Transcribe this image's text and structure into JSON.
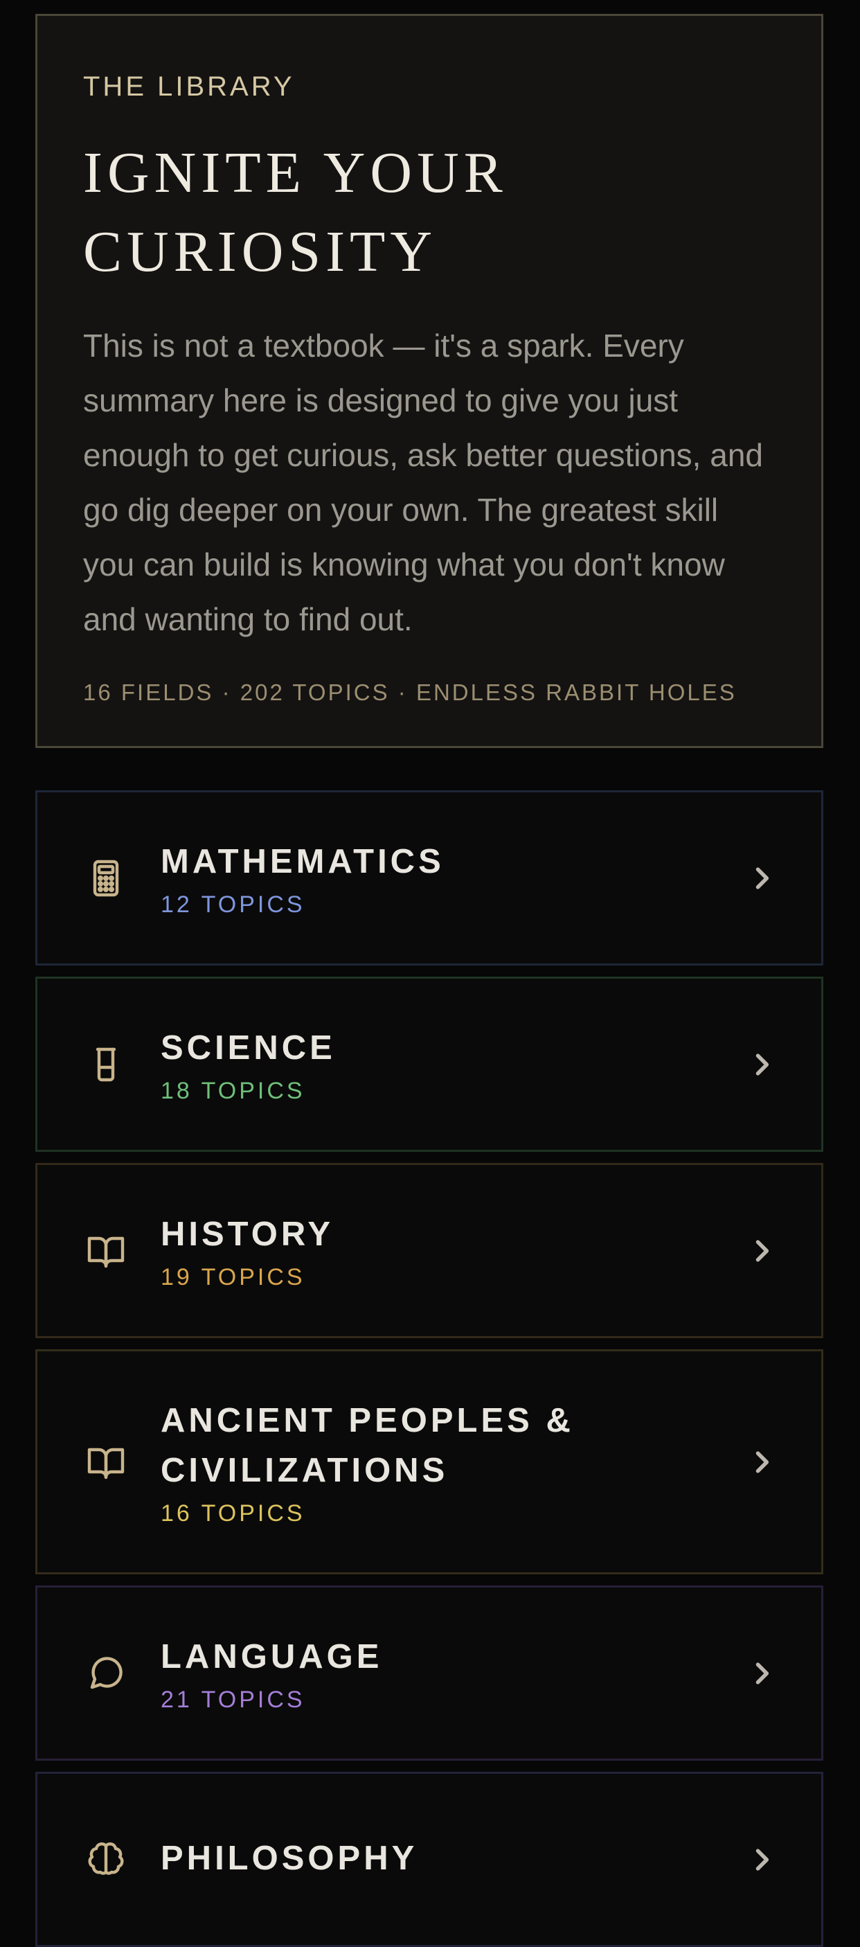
{
  "hero": {
    "eyebrow": "THE LIBRARY",
    "title": "IGNITE YOUR CURIOSITY",
    "body": "This is not a textbook — it's a spark. Every summary here is designed to give you just enough to get curious, ask better questions, and go dig deeper on your own. The greatest skill you can build is knowing what you don't know and wanting to find out.",
    "stats": "16 FIELDS · 202 TOPICS · ENDLESS RABBIT HOLES"
  },
  "fields": [
    {
      "name": "MATHEMATICS",
      "count": "12 TOPICS",
      "icon": "calculator-icon",
      "accent": "#7e96dc",
      "border": "#1e2638"
    },
    {
      "name": "SCIENCE",
      "count": "18 TOPICS",
      "icon": "beaker-icon",
      "accent": "#6fbf7a",
      "border": "#1f3324"
    },
    {
      "name": "HISTORY",
      "count": "19 TOPICS",
      "icon": "open-book-icon",
      "accent": "#d9a64e",
      "border": "#33291a"
    },
    {
      "name": "ANCIENT PEOPLES & CIVILIZATIONS",
      "count": "16 TOPICS",
      "icon": "open-book-icon",
      "accent": "#dcc25e",
      "border": "#332c1a"
    },
    {
      "name": "LANGUAGE",
      "count": "21 TOPICS",
      "icon": "speech-bubble-icon",
      "accent": "#a47ed6",
      "border": "#271f38"
    },
    {
      "name": "PHILOSOPHY",
      "count": "",
      "icon": "brain-icon",
      "accent": "#8a8fd6",
      "border": "#22223a"
    }
  ]
}
